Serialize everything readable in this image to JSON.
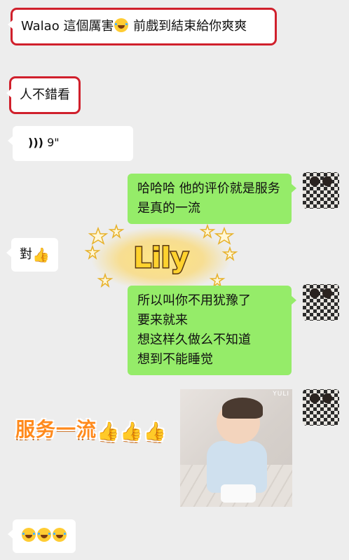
{
  "messages": [
    {
      "text_before": "Walao 這個厲害",
      "emoji": "laughing-tears",
      "text_after": " 前戲到結束給你爽爽"
    },
    {
      "text": "人不錯看"
    },
    {
      "voice_duration": "9\""
    },
    {
      "text": "哈哈哈 他的评价就是服务是真的一流"
    },
    {
      "text": "對"
    },
    {
      "text_lines": [
        "所以叫你不用犹豫了",
        "要来就来",
        "想这样久做么不知道",
        "想到不能睡觉"
      ]
    },
    {
      "emoji_count": 3
    }
  ],
  "stickers": {
    "lily": "Lily",
    "caption": "服务一流"
  },
  "photo": {
    "watermark": "YULI"
  },
  "colors": {
    "outgoing_bubble": "#95ec69",
    "incoming_bubble": "#ffffff",
    "highlight_box": "#d0202c",
    "background": "#ededed"
  },
  "icons": [
    "voice-icon",
    "laughing-tears-emoji",
    "thumbs-up-emoji",
    "star-icon"
  ]
}
